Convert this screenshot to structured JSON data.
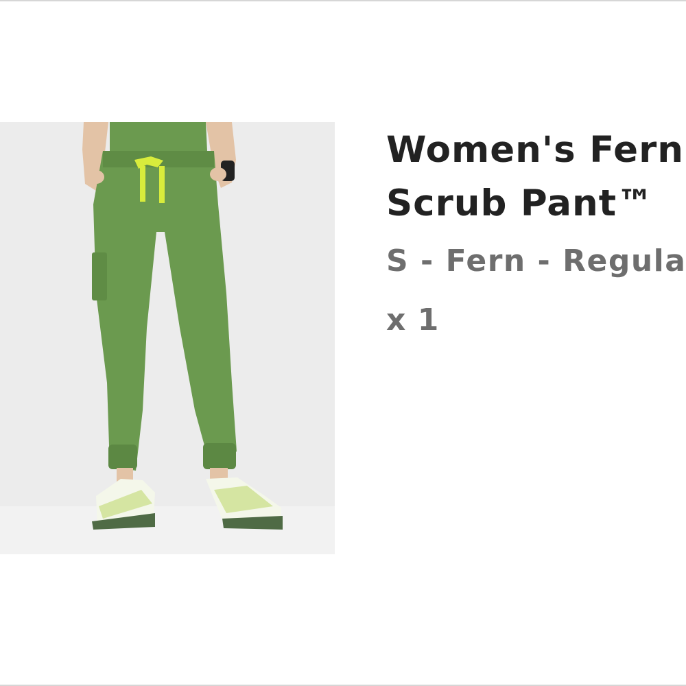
{
  "line_item": {
    "name_line1": "Women's Fern",
    "name_line2": "Scrub Pant™",
    "variant": "S - Fern - Regular",
    "quantity": "x 1"
  },
  "colors": {
    "pant_green": "#6b9a4f",
    "drawstring": "#d8ec3c",
    "title": "#222222",
    "secondary_text": "#6e6e6e",
    "image_background": "#eceded"
  }
}
